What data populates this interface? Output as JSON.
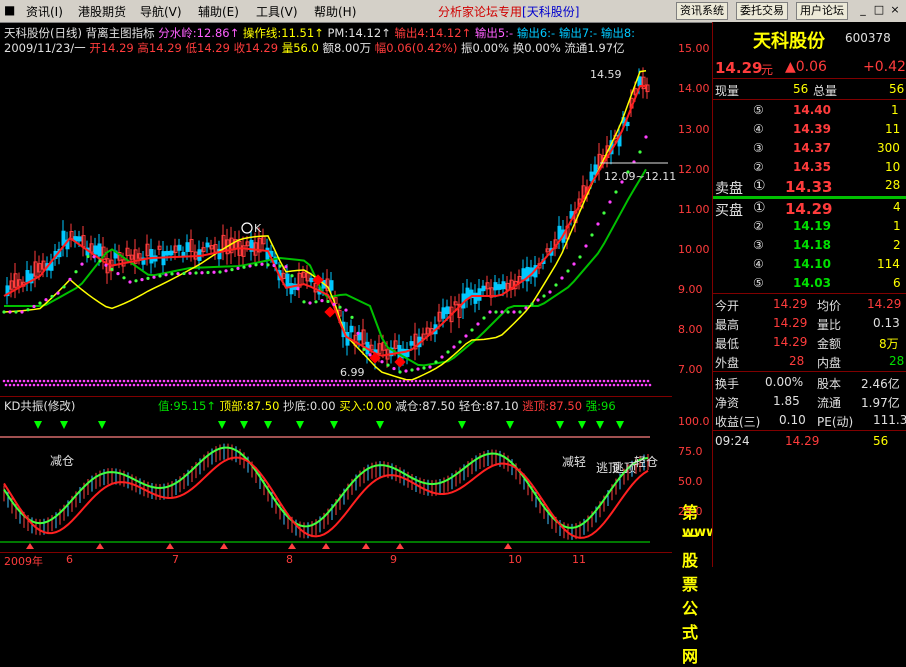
{
  "menu": {
    "items": [
      "资讯(I)",
      "港股期货",
      "导航(V)",
      "辅助(E)",
      "工具(V)",
      "帮助(H)"
    ],
    "title_prefix": "分析家论坛专用",
    "title_stock": "[天科股份]",
    "buttons": [
      "资讯系统",
      "委托交易",
      "用户论坛"
    ],
    "controls": [
      "_",
      "□",
      "×"
    ]
  },
  "main_chart": {
    "row1": {
      "stock": "天科股份(日线)",
      "indicator": "背离主图指标",
      "fsl": "分水岭:12.86↑",
      "czx": "操作线:11.51↑",
      "pm": "PM:14.12↑",
      "sc4": "输出4:14.12↑",
      "sc5": "输出5:-",
      "sc6": "输出6:-",
      "sc7": "输出7:-",
      "sc8": "输出8:"
    },
    "row2": {
      "date": "2009/11/23/一",
      "open": "开14.29",
      "high": "高14.29",
      "low": "低14.29",
      "close": "收14.29",
      "vol": "量56.0",
      "amt": "额8.00万",
      "chg": "幅0.06(0.42%)",
      "amp": "振0.00%",
      "turn": "换0.00%",
      "float": "流通1.97亿"
    },
    "annotations": {
      "high_mark": "14.59",
      "low_mark": "6.99",
      "range_mark": "12.09~12.11",
      "k_mark": "K"
    },
    "price_axis": [
      "15.00",
      "14.00",
      "13.00",
      "12.00",
      "11.00",
      "10.00",
      "9.00",
      "8.00",
      "7.00"
    ]
  },
  "kd_chart": {
    "title": "KD共振(修改)",
    "val": "值:95.15↑",
    "top": "顶部:87.50",
    "bottom": "抄底:0.00",
    "buy": "买入:0.00",
    "reduce": "减仓:87.50",
    "light": "轻仓:87.10",
    "escape": "逃顶:87.50",
    "strong": "强:96",
    "axis": [
      "100.0",
      "75.0",
      "50.0",
      "25.0"
    ],
    "labels": [
      "减仓",
      "减轻",
      "逃顶",
      "逃顶",
      "轻仓"
    ],
    "watermark1": "第一股票公式网",
    "watermark2": "www.chnmoney.com"
  },
  "date_axis": [
    "2009年",
    "6",
    "7",
    "8",
    "9",
    "10",
    "11"
  ],
  "quote": {
    "name": "天科股份",
    "code": "600378",
    "price": "14.29",
    "unit": "元",
    "change": "▲0.06",
    "change2": "+0.42",
    "now_vol_label": "现量",
    "now_vol": "56",
    "total_vol_label": "总量",
    "total_vol": "56",
    "sell": [
      {
        "no": "⑤",
        "price": "14.40",
        "vol": "1"
      },
      {
        "no": "④",
        "price": "14.39",
        "vol": "11"
      },
      {
        "no": "③",
        "price": "14.37",
        "vol": "300"
      },
      {
        "no": "②",
        "price": "14.35",
        "vol": "10"
      }
    ],
    "sell1": {
      "label": "卖盘",
      "no": "①",
      "price": "14.33",
      "vol": "28"
    },
    "buy1": {
      "label": "买盘",
      "no": "①",
      "price": "14.29",
      "vol": "4"
    },
    "buy": [
      {
        "no": "②",
        "price": "14.19",
        "vol": "1"
      },
      {
        "no": "③",
        "price": "14.18",
        "vol": "2"
      },
      {
        "no": "④",
        "price": "14.10",
        "vol": "114"
      },
      {
        "no": "⑤",
        "price": "14.03",
        "vol": "6"
      }
    ],
    "stats": [
      {
        "l1": "今开",
        "v1": "14.29",
        "l2": "均价",
        "v2": "14.29"
      },
      {
        "l1": "最高",
        "v1": "14.29",
        "l2": "量比",
        "v2": "0.13"
      },
      {
        "l1": "最低",
        "v1": "14.29",
        "l2": "金额",
        "v2": "8万"
      },
      {
        "l1": "外盘",
        "v1": "28",
        "l2": "内盘",
        "v2": "28"
      }
    ],
    "fin": [
      {
        "l1": "换手",
        "v1": "0.00%",
        "l2": "股本",
        "v2": "2.46亿"
      },
      {
        "l1": "净资",
        "v1": "1.85",
        "l2": "流通",
        "v2": "1.97亿"
      },
      {
        "l1": "收益(三)",
        "v1": "0.10",
        "l2": "PE(动)",
        "v2": "111.3"
      }
    ],
    "tick": {
      "time": "09:24",
      "price": "14.29",
      "vol": "56"
    }
  },
  "colors": {
    "up": "#ff3c3c",
    "down": "#00e000",
    "info_yellow": "#ffff00",
    "axis_red": "#c00000"
  }
}
